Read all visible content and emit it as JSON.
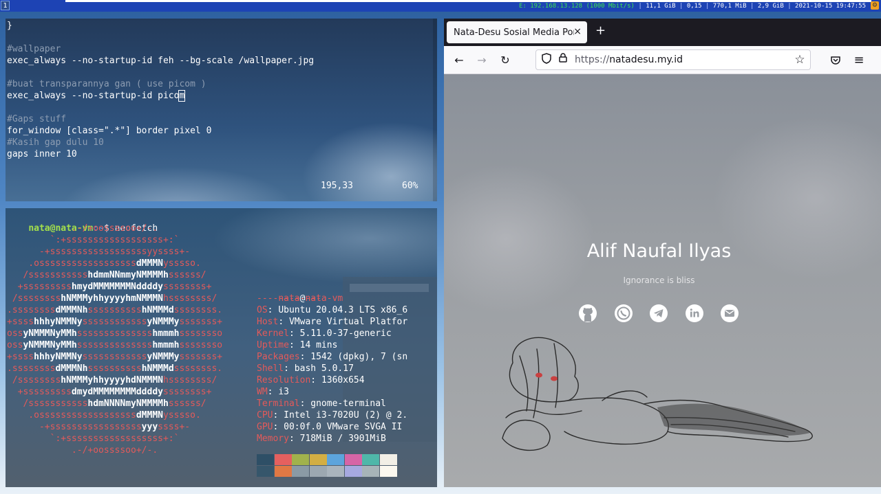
{
  "topbar": {
    "workspace": "1",
    "net": "E: 192.168.13.128 (1000 Mbit/s)",
    "disk": "11,1 GiB",
    "load": "0,15",
    "memory": "770,1 MiB",
    "mem2": "2,9 GiB",
    "datetime": "2021-10-15 19:47:55",
    "sep": "|"
  },
  "vim": {
    "lines": [
      {
        "text": "}",
        "type": "code"
      },
      {
        "text": "",
        "type": "code"
      },
      {
        "text": "#wallpaper",
        "type": "comment"
      },
      {
        "text": "exec_always --no-startup-id feh --bg-scale /wallpaper.jpg",
        "type": "code"
      },
      {
        "text": "",
        "type": "code"
      },
      {
        "text": "#buat transparannya gan ( use picom )",
        "type": "comment"
      },
      {
        "text": "exec_always --no-startup-id pico",
        "type": "code",
        "cursor": "m"
      },
      {
        "text": "",
        "type": "code"
      },
      {
        "text": "#Gaps stuff",
        "type": "comment"
      },
      {
        "text": "for_window [class=\".*\"] border pixel 0",
        "type": "code"
      },
      {
        "text": "#Kasih gap dulu 10",
        "type": "comment"
      },
      {
        "text": "gaps inner 10",
        "type": "code"
      }
    ],
    "ruler": "195,33",
    "percent": "60%"
  },
  "terminal": {
    "prompt_user": "nata",
    "prompt_at": "@",
    "prompt_host": "nata-vm",
    "prompt_path": ":~",
    "prompt_sym": "$ ",
    "command": "neofetch",
    "logo": [
      "            .-/+oossssoo+/-.",
      "        `:+ssssssssssssssssss+:`",
      "      -+ssssssssssssssssssyyssss+-",
      "    .ossssssssssssssssssdMMMNysssso.",
      "   /ssssssssssshdmmNNmmyNMMMMhssssss/",
      "  +ssssssssshmydMMMMMMMNddddyssssssss+",
      " /sssssssshNMMMyhhyyyyhmNMMMNhssssssss/",
      ".ssssssssdMMMNhsssssssssshNMMMdssssssss.",
      "+sssshhhyNMMNyssssssssssssyNMMMysssssss+",
      "ossyNMMMNyMMhsssssssssssssshmmmhssssssso",
      "ossyNMMMNyMMhsssssssssssssshmmmhssssssso",
      "+sssshhhyNMMNyssssssssssssyNMMMysssssss+",
      ".ssssssssdMMMNhsssssssssshNMMMdssssssss.",
      " /sssssssshNMMMyhhyyyyhdNMMMNhssssssss/",
      "  +sssssssssdmydMMMMMMMMddddyssssssss+",
      "   /ssssssssssshdmNNNNmyNMMMMhssssss/",
      "    .ossssssssssssssssssdMMMNysssso.",
      "      -+sssssssssssssssssyyyssss+-",
      "        `:+ssssssssssssssssss+:`",
      "            .-/+oossssoo+/-."
    ],
    "info_user": "nata",
    "info_at": "@",
    "info_host": "nata-vm",
    "info_sep": "------------",
    "info": [
      {
        "key": "OS",
        "value": "Ubuntu 20.04.3 LTS x86_6"
      },
      {
        "key": "Host",
        "value": "VMware Virtual Platfor"
      },
      {
        "key": "Kernel",
        "value": "5.11.0-37-generic"
      },
      {
        "key": "Uptime",
        "value": "14 mins"
      },
      {
        "key": "Packages",
        "value": "1542 (dpkg), 7 (sn"
      },
      {
        "key": "Shell",
        "value": "bash 5.0.17"
      },
      {
        "key": "Resolution",
        "value": "1360x654"
      },
      {
        "key": "WM",
        "value": "i3"
      },
      {
        "key": "Terminal",
        "value": "gnome-terminal"
      },
      {
        "key": "CPU",
        "value": "Intel i3-7020U (2) @ 2."
      },
      {
        "key": "GPU",
        "value": "00:0f.0 VMware SVGA II"
      },
      {
        "key": "Memory",
        "value": "718MiB / 3901MiB"
      }
    ],
    "colon": ": ",
    "palette_top": [
      "#2e4f66",
      "#e5605f",
      "#a1b24c",
      "#d3ae43",
      "#5ca4dc",
      "#d665a6",
      "#4fb7a9",
      "#f2efe6"
    ],
    "palette_bottom": [
      "#36566b",
      "#e07844",
      "#8a9aa5",
      "#9ca8b1",
      "#a9b4bd",
      "#a6a9e0",
      "#a7b4b8",
      "#fbf8ef"
    ]
  },
  "firefox": {
    "tab_title": "Nata-Desu Sosial Media Port",
    "tab_close": "×",
    "new_tab": "+",
    "url_prefix": "https://",
    "url_domain": "natadesu.my.id",
    "back": "←",
    "forward": "→",
    "reload": "↻",
    "bookmark": "☆",
    "menu": "≡",
    "page": {
      "name": "Alif Naufal Ilyas",
      "tagline": "Ignorance is bliss"
    }
  }
}
